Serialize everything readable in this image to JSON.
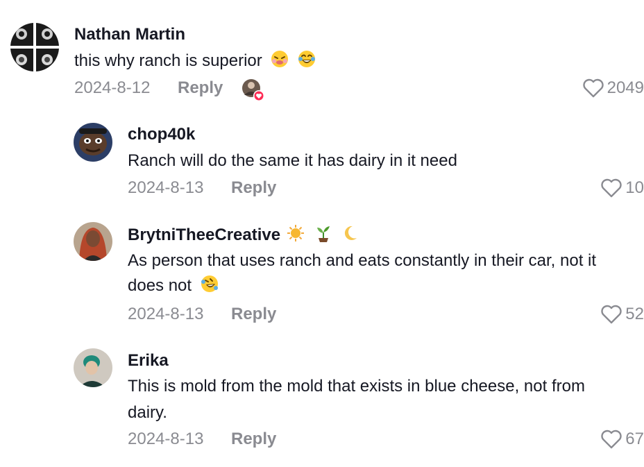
{
  "comments": [
    {
      "username": "Nathan Martin",
      "text": "this why ranch is superior",
      "emojis": [
        "tired-face-emoji",
        "laughing-emoji"
      ],
      "date": "2024-8-12",
      "reply": "Reply",
      "likes": "2049",
      "creator_liked": true
    },
    {
      "username": "chop40k",
      "text": "Ranch will do the same it has dairy in it need",
      "date": "2024-8-13",
      "reply": "Reply",
      "likes": "10"
    },
    {
      "username": "BrytniTheeCreative",
      "username_emojis": [
        "sun-emoji",
        "seedling-emoji",
        "crescent-moon-emoji"
      ],
      "text_line1": "As person that uses ranch and eats constantly in their car, not it",
      "text_line2": "does not",
      "text_emoji": "rofl-emoji",
      "date": "2024-8-13",
      "reply": "Reply",
      "likes": "52"
    },
    {
      "username": "Erika",
      "text_line1": "This is mold from the mold that exists in blue cheese, not from",
      "text_line2": "dairy.",
      "date": "2024-8-13",
      "reply": "Reply",
      "likes": "67"
    }
  ]
}
